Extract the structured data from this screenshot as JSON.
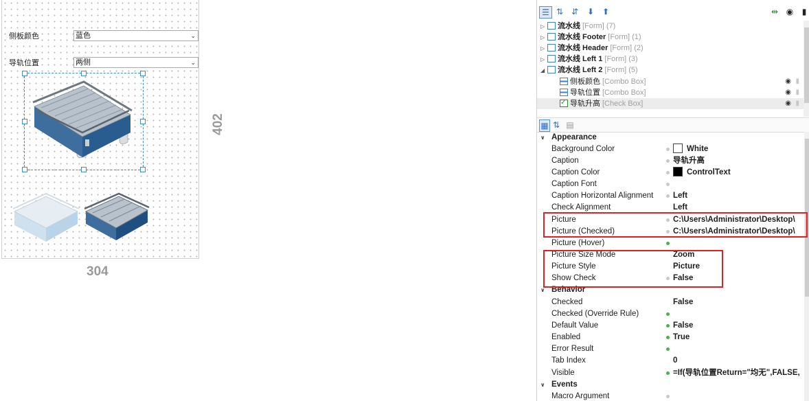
{
  "designer": {
    "side_color_label": "侧板颜色",
    "side_color_value": "蓝色",
    "rail_position_label": "导轨位置",
    "rail_position_value": "两侧",
    "height_dim": "402",
    "width_dim": "304"
  },
  "tree": {
    "rows": [
      {
        "name": "流水线",
        "type": "[Form] (7)"
      },
      {
        "name": "流水线 Footer",
        "type": "[Form] (1)"
      },
      {
        "name": "流水线 Header",
        "type": "[Form] (2)"
      },
      {
        "name": "流水线 Left 1",
        "type": "[Form] (3)"
      },
      {
        "name": "流水线 Left 2",
        "type": "[Form] (5)"
      },
      {
        "name": "侧板颜色",
        "type": "[Combo Box]"
      },
      {
        "name": "导轨位置",
        "type": "[Combo Box]"
      },
      {
        "name": "导轨升高",
        "type": "[Check Box]"
      }
    ]
  },
  "properties": {
    "appearance": "Appearance",
    "behavior": "Behavior",
    "events": "Events",
    "rows": [
      {
        "name": "Background Color",
        "value": "White"
      },
      {
        "name": "Caption",
        "value": "导轨升高"
      },
      {
        "name": "Caption Color",
        "value": "ControlText"
      },
      {
        "name": "Caption Font",
        "value": ""
      },
      {
        "name": "Caption Horizontal Alignment",
        "value": "Left"
      },
      {
        "name": "Check Alignment",
        "value": "Left"
      },
      {
        "name": "Picture",
        "value": "C:\\Users\\Administrator\\Desktop\\"
      },
      {
        "name": "Picture (Checked)",
        "value": "C:\\Users\\Administrator\\Desktop\\"
      },
      {
        "name": "Picture (Hover)",
        "value": ""
      },
      {
        "name": "Picture Size Mode",
        "value": "Zoom"
      },
      {
        "name": "Picture Style",
        "value": "Picture"
      },
      {
        "name": "Show Check",
        "value": "False"
      },
      {
        "name": "Checked",
        "value": "False"
      },
      {
        "name": "Checked (Override Rule)",
        "value": ""
      },
      {
        "name": "Default Value",
        "value": "False"
      },
      {
        "name": "Enabled",
        "value": "True"
      },
      {
        "name": "Error Result",
        "value": ""
      },
      {
        "name": "Tab Index",
        "value": "0"
      },
      {
        "name": "Visible",
        "value": "=If(导轨位置Return=\"均无\",FALSE,"
      },
      {
        "name": "Macro Argument",
        "value": ""
      }
    ]
  },
  "colors": {
    "highlight": "#e3201f",
    "selection": "#3c8dd8",
    "conveyor": "#2a5d8f"
  }
}
